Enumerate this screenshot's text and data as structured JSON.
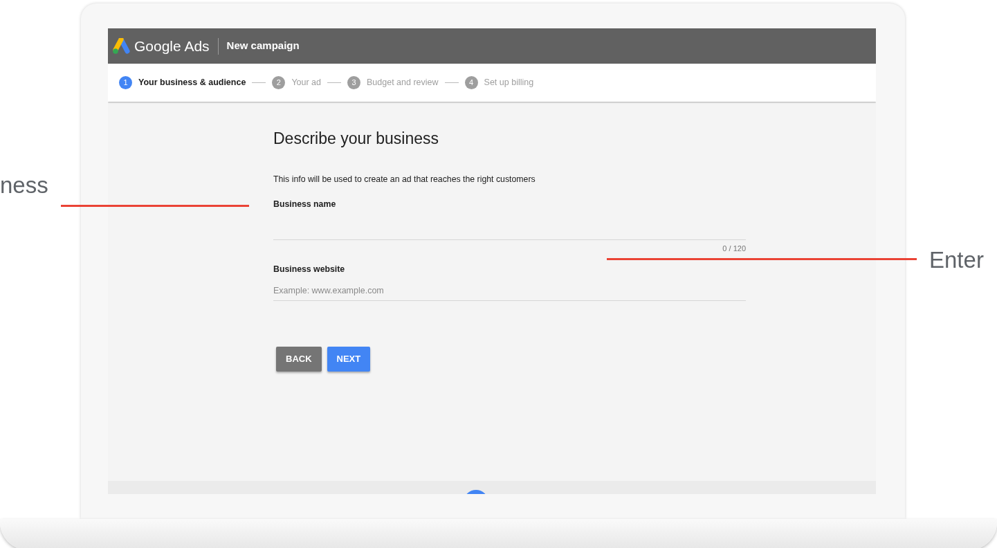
{
  "header": {
    "product": "Google Ads",
    "title": "New campaign"
  },
  "steps": [
    {
      "number": "1",
      "label": "Your business & audience",
      "selected": true
    },
    {
      "number": "2",
      "label": "Your ad",
      "selected": false
    },
    {
      "number": "3",
      "label": "Budget and review",
      "selected": false
    },
    {
      "number": "4",
      "label": "Set up billing",
      "selected": false
    }
  ],
  "form": {
    "title": "Describe your business",
    "description": "This info will be used to create an ad that reaches the right customers",
    "fields": [
      {
        "label": "Business name",
        "counter": "0 / 120"
      },
      {
        "label": "Business website",
        "placeholder": "Example: www.example.com"
      }
    ]
  },
  "buttons": [
    {
      "label": "BACK",
      "kind": "secondary"
    },
    {
      "label": "NEXT",
      "kind": "primary"
    }
  ],
  "callout_left": {
    "text": "ness"
  },
  "callout_right": {
    "text": "Enter"
  }
}
